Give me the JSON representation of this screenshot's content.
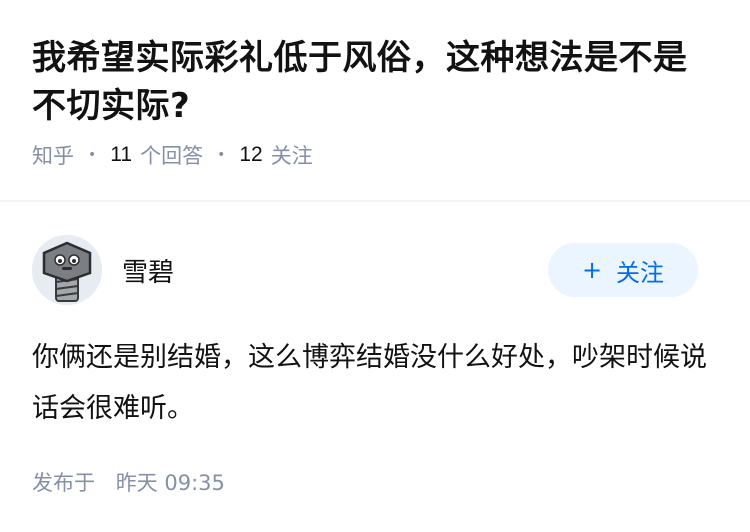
{
  "question": {
    "title": "我希望实际彩礼低于风俗，这种想法是不是不切实际?",
    "source": "知乎",
    "answer_count": "11",
    "answer_label": "个回答",
    "follow_count": "12",
    "follow_label": "关注"
  },
  "answer": {
    "author_name": "雪碧",
    "avatar_icon": "robot-avatar-icon",
    "follow_button": "关注",
    "follow_icon": "plus-icon",
    "content": "你俩还是别结婚，这么博弈结婚没什么好处，吵架时候说话会很难听。",
    "publish_label": "发布于",
    "publish_time": "昨天 09:35"
  },
  "colors": {
    "accent": "#056de8",
    "button_bg": "#ebf5ff",
    "meta_gray": "#8590a6",
    "text": "#121212"
  }
}
